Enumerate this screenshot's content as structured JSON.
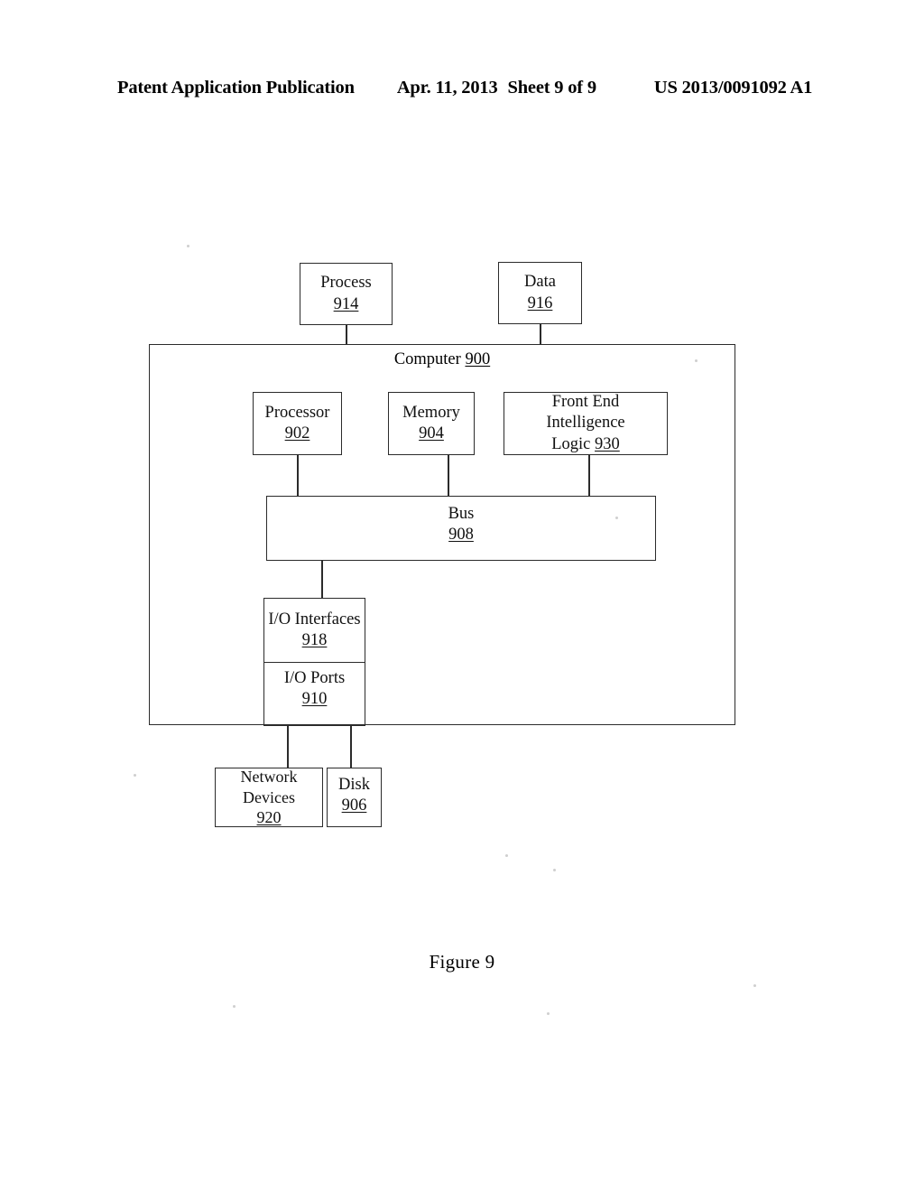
{
  "header": {
    "publication": "Patent Application Publication",
    "date": "Apr. 11, 2013",
    "sheet": "Sheet 9 of 9",
    "patent_number": "US 2013/0091092 A1"
  },
  "figure": {
    "caption": "Figure 9",
    "container": {
      "label_text": "Computer",
      "label_ref": "900"
    },
    "blocks": {
      "process": {
        "line1": "Process",
        "ref": "914"
      },
      "data": {
        "line1": "Data",
        "ref": "916"
      },
      "processor": {
        "line1": "Processor",
        "ref": "902"
      },
      "memory": {
        "line1": "Memory",
        "ref": "904"
      },
      "front_end_logic": {
        "line1": "Front End",
        "line2": "Intelligence",
        "line3_text": "Logic",
        "ref": "930"
      },
      "bus": {
        "line1": "Bus",
        "ref": "908"
      },
      "io_interfaces": {
        "line1": "I/O Interfaces",
        "ref": "918"
      },
      "io_ports": {
        "line1": "I/O Ports",
        "ref": "910"
      },
      "network_devices": {
        "line1": "Network",
        "line2": "Devices",
        "ref": "920"
      },
      "disk": {
        "line1": "Disk",
        "ref": "906"
      }
    }
  },
  "colors": {
    "ink": "#2b2b2b",
    "paper": "#ffffff"
  }
}
